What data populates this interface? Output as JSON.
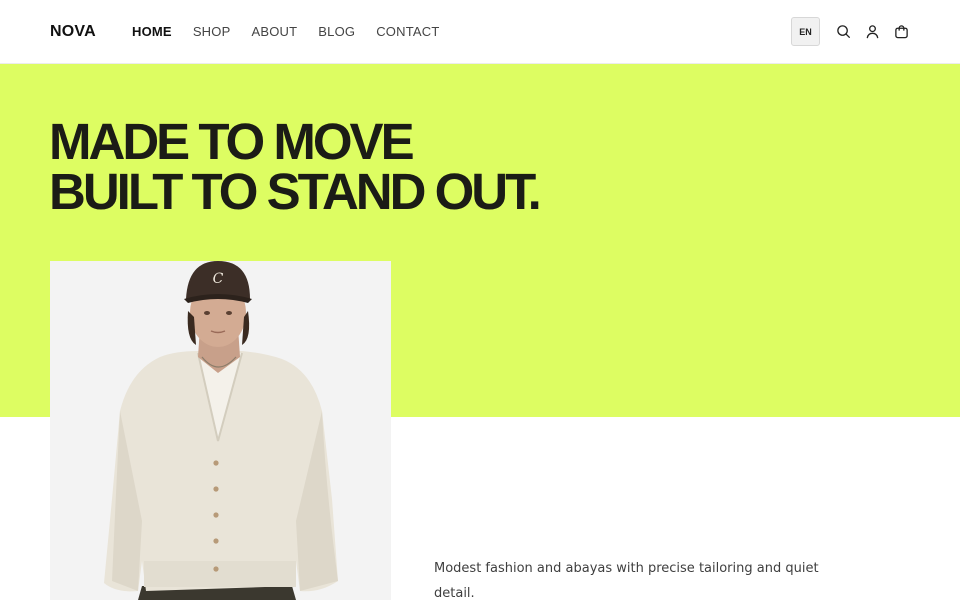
{
  "brand": {
    "name": "NOVA"
  },
  "nav": {
    "items": [
      {
        "label": "HOME",
        "active": true
      },
      {
        "label": "SHOP",
        "active": false
      },
      {
        "label": "ABOUT",
        "active": false
      },
      {
        "label": "BLOG",
        "active": false
      },
      {
        "label": "CONTACT",
        "active": false
      }
    ]
  },
  "header": {
    "language": "EN",
    "icons": [
      "search-icon",
      "user-icon",
      "cart-icon"
    ]
  },
  "hero": {
    "headline_line1": "MADE TO MOVE",
    "headline_line2": "BUILT TO STAND OUT.",
    "tagline": "Modest fashion and abayas with precise tailoring and quiet detail.",
    "product_image": "model wearing dark cap and cream cardigan"
  },
  "colors": {
    "accent": "#ddfd62",
    "text_dark": "#1b1c16",
    "body_text": "#3f3f3f",
    "background": "#ffffff"
  }
}
